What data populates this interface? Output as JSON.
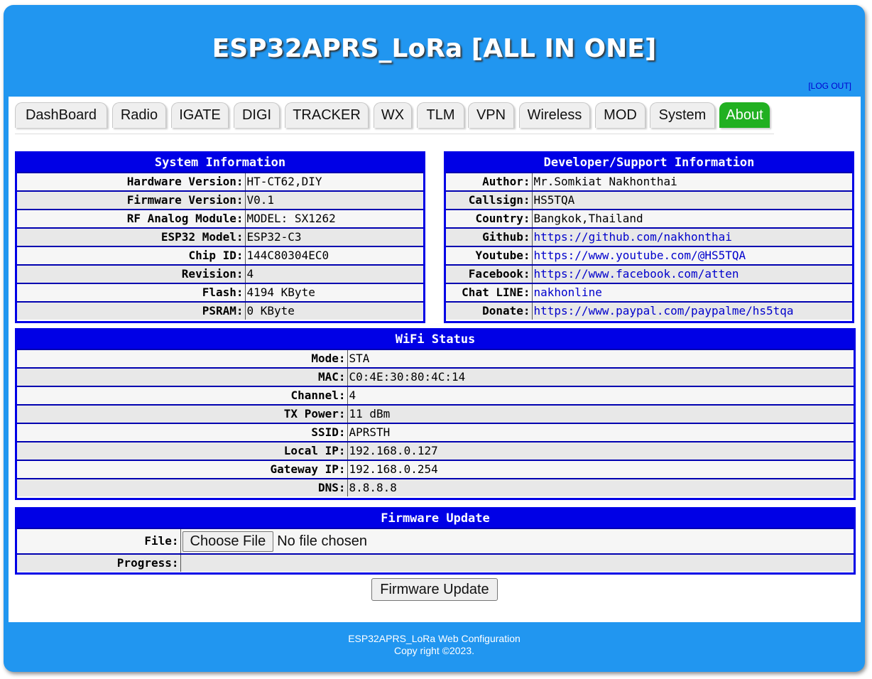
{
  "header": {
    "title": "ESP32APRS_LoRa [ALL IN ONE]",
    "logout": "[LOG OUT]"
  },
  "tabs": [
    {
      "label": "DashBoard",
      "active": false
    },
    {
      "label": "Radio",
      "active": false
    },
    {
      "label": "IGATE",
      "active": false
    },
    {
      "label": "DIGI",
      "active": false
    },
    {
      "label": "TRACKER",
      "active": false
    },
    {
      "label": "WX",
      "active": false
    },
    {
      "label": "TLM",
      "active": false
    },
    {
      "label": "VPN",
      "active": false
    },
    {
      "label": "Wireless",
      "active": false
    },
    {
      "label": "MOD",
      "active": false
    },
    {
      "label": "System",
      "active": false
    },
    {
      "label": "About",
      "active": true
    }
  ],
  "system_info": {
    "title": "System Information",
    "rows": [
      {
        "label": "Hardware Version:",
        "value": "HT-CT62,DIY"
      },
      {
        "label": "Firmware Version:",
        "value": "V0.1"
      },
      {
        "label": "RF Analog Module:",
        "value": "MODEL: SX1262"
      },
      {
        "label": "ESP32 Model:",
        "value": "ESP32-C3"
      },
      {
        "label": "Chip ID:",
        "value": "144C80304EC0"
      },
      {
        "label": "Revision:",
        "value": "4"
      },
      {
        "label": "Flash:",
        "value": "4194 KByte"
      },
      {
        "label": "PSRAM:",
        "value": "0 KByte"
      }
    ]
  },
  "developer_info": {
    "title": "Developer/Support Information",
    "rows": [
      {
        "label": "Author:",
        "value": "Mr.Somkiat Nakhonthai"
      },
      {
        "label": "Callsign:",
        "value": "HS5TQA"
      },
      {
        "label": "Country:",
        "value": "Bangkok,Thailand"
      },
      {
        "label": "Github:",
        "value": "https://github.com/nakhonthai"
      },
      {
        "label": "Youtube:",
        "value": "https://www.youtube.com/@HS5TQA"
      },
      {
        "label": "Facebook:",
        "value": "https://www.facebook.com/atten"
      },
      {
        "label": "Chat LINE:",
        "value": "nakhonline"
      },
      {
        "label": "Donate:",
        "value": "https://www.paypal.com/paypalme/hs5tqa"
      }
    ]
  },
  "wifi_status": {
    "title": "WiFi Status",
    "rows": [
      {
        "label": "Mode:",
        "value": "STA"
      },
      {
        "label": "MAC:",
        "value": "C0:4E:30:80:4C:14"
      },
      {
        "label": "Channel:",
        "value": "4"
      },
      {
        "label": "TX Power:",
        "value": "11 dBm"
      },
      {
        "label": "SSID:",
        "value": "APRSTH"
      },
      {
        "label": "Local IP:",
        "value": "192.168.0.127"
      },
      {
        "label": "Gateway IP:",
        "value": "192.168.0.254"
      },
      {
        "label": "DNS:",
        "value": "8.8.8.8"
      }
    ]
  },
  "firmware_update": {
    "title": "Firmware Update",
    "file_label": "File:",
    "choose_file": "Choose File",
    "no_file": "No file chosen",
    "progress_label": "Progress:",
    "update_button": "Firmware Update"
  },
  "footer": {
    "line1": "ESP32APRS_LoRa Web Configuration",
    "line2": "Copy right ©2023."
  },
  "colors": {
    "frame": "#2196f0",
    "panel_border": "#0000e6",
    "active_tab": "#21b021",
    "link": "#0000cc"
  }
}
